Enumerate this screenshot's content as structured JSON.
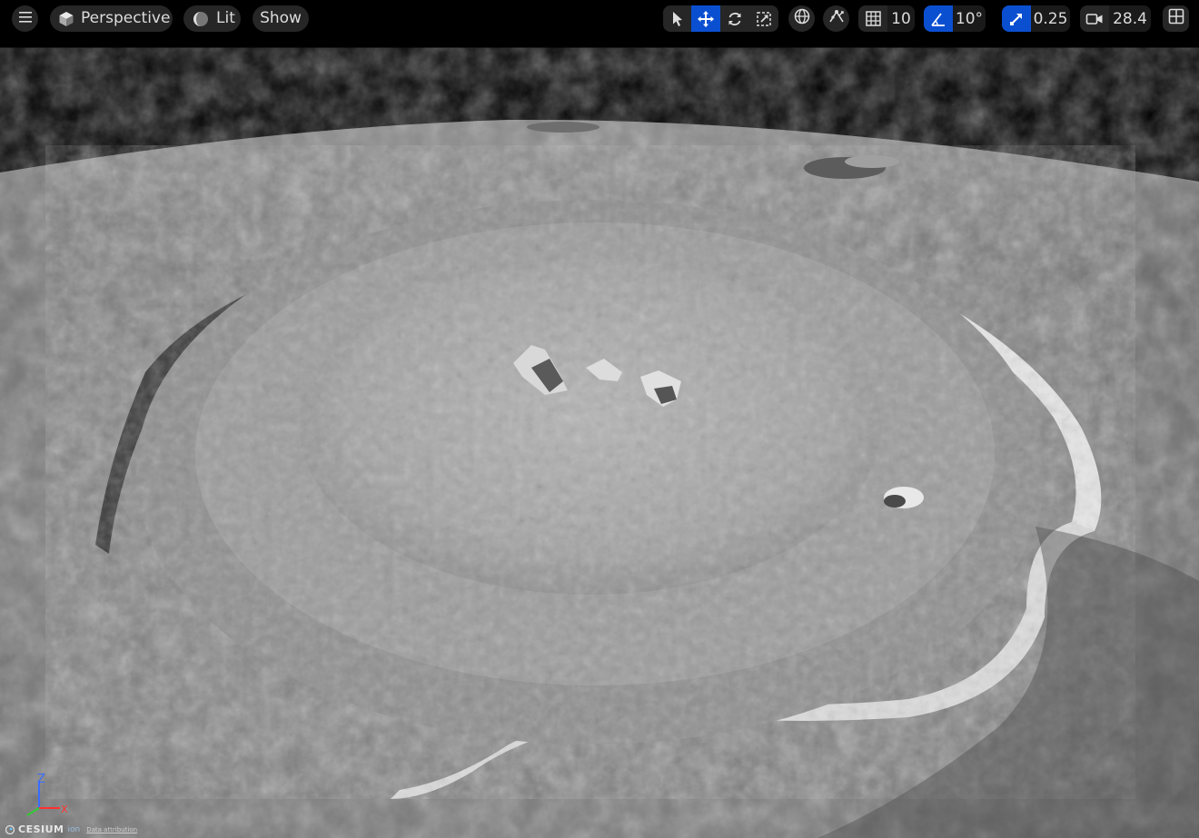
{
  "viewport": {
    "view_mode_label": "Perspective",
    "lighting_label": "Lit",
    "show_label": "Show"
  },
  "toolbar": {
    "grid_snap_value": "10",
    "rotation_snap_value": "10°",
    "scale_snap_value": "0.25",
    "camera_speed_value": "28.4"
  },
  "axis_gizmo": {
    "z": "Z",
    "x": "X"
  },
  "footer": {
    "logo_text": "CESIUM",
    "logo_suffix": "ion",
    "attribution_link": "Data attribution"
  }
}
